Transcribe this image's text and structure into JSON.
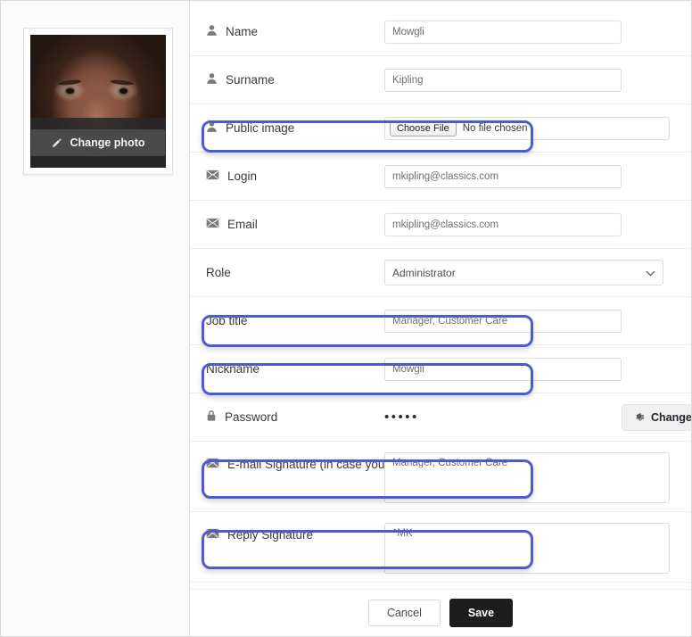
{
  "photo": {
    "change_photo_label": "Change photo",
    "pencil_icon": "pencil-icon",
    "alt": "user portrait"
  },
  "form": {
    "rows": [
      {
        "icon": "user-icon",
        "label": "Name",
        "value": "Mowgli",
        "control": "text"
      },
      {
        "icon": "user-icon",
        "label": "Surname",
        "value": "Kipling",
        "control": "text"
      },
      {
        "icon": "user-icon",
        "label": "Public image",
        "control": "file",
        "choose_file_label": "Choose File",
        "no_file_label": "No file chosen"
      },
      {
        "icon": "envelope-icon",
        "label": "Login",
        "value": "mkipling@classics.com",
        "control": "text"
      },
      {
        "icon": "envelope-icon",
        "label": "Email",
        "value": "mkipling@classics.com",
        "control": "text"
      },
      {
        "icon": "none",
        "label": "Role",
        "value": "Administrator",
        "control": "select",
        "options": [
          "Administrator"
        ]
      },
      {
        "icon": "none",
        "label": "Job title",
        "value": "Manager, Customer Care",
        "control": "text"
      },
      {
        "icon": "none",
        "label": "Nickname",
        "value": "Mowgli",
        "control": "text"
      },
      {
        "icon": "lock-icon",
        "label": "Password",
        "value": "•••••",
        "control": "password",
        "change_password_label": "Change password",
        "gear_icon": "gear-icon"
      },
      {
        "icon": "envelope-icon",
        "label": "E-mail Signature (in case you are u",
        "value": "Manager, Customer Care",
        "control": "textarea"
      },
      {
        "icon": "envelope-icon",
        "label": "Reply Signature",
        "value": "^MK",
        "control": "textarea"
      }
    ]
  },
  "footer": {
    "cancel_label": "Cancel",
    "save_label": "Save"
  },
  "colors": {
    "highlight": "#4b5ad6",
    "save_bg": "#1d1d1d",
    "page_bg": "#ffffff"
  }
}
